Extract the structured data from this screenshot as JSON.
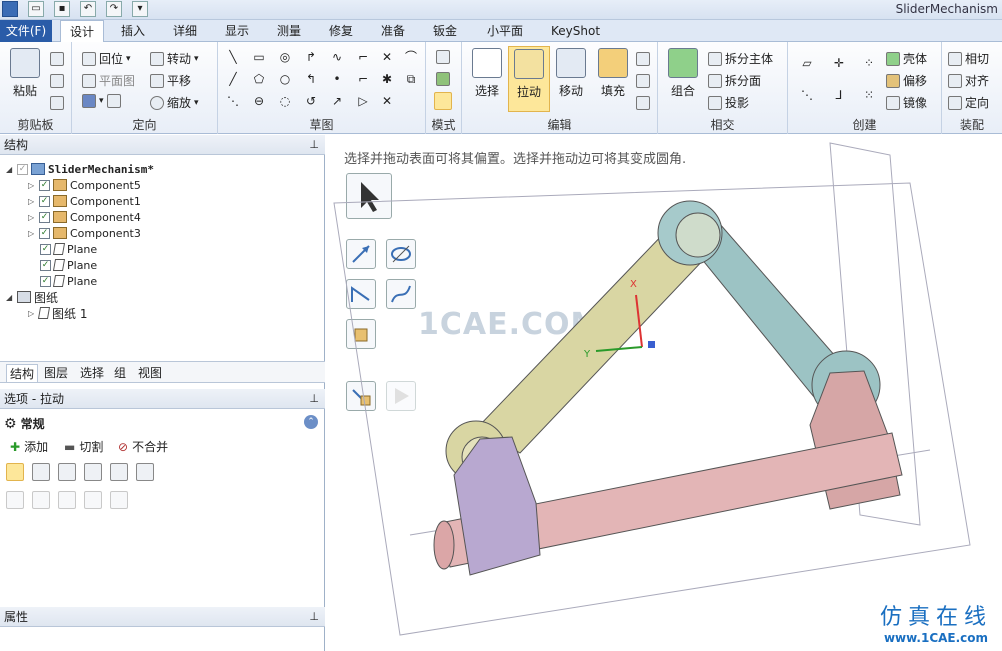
{
  "window": {
    "title": "SliderMechanism"
  },
  "tabs": [
    {
      "label": "文件(F)"
    },
    {
      "label": "设计"
    },
    {
      "label": "插入"
    },
    {
      "label": "详细"
    },
    {
      "label": "显示"
    },
    {
      "label": "测量"
    },
    {
      "label": "修复"
    },
    {
      "label": "准备"
    },
    {
      "label": "钣金"
    },
    {
      "label": "小平面"
    },
    {
      "label": "KeyShot"
    }
  ],
  "ribbon": {
    "clipboard": {
      "label": "剪贴板",
      "paste": "粘贴"
    },
    "orient": {
      "label": "定向",
      "home": "回位",
      "plan_view": "平面图",
      "spin": "转动",
      "pan": "平移",
      "zoom": "缩放"
    },
    "sketch": {
      "label": "草图"
    },
    "mode": {
      "label": "模式"
    },
    "edit": {
      "label": "编辑",
      "select": "选择",
      "pull": "拉动",
      "move": "移动",
      "fill": "填充"
    },
    "intersect": {
      "label": "相交",
      "combine": "组合",
      "split_body": "拆分主体",
      "split_face": "拆分面",
      "project": "投影"
    },
    "create": {
      "label": "创建",
      "shell": "壳体",
      "offset": "偏移",
      "mirror": "镜像"
    },
    "assembly": {
      "label": "装配",
      "tangent": "相切",
      "align": "对齐",
      "orient": "定向"
    }
  },
  "structure": {
    "title": "结构",
    "root": "SliderMechanism*",
    "components": [
      "Component5",
      "Component1",
      "Component4",
      "Component3"
    ],
    "planes": [
      "Plane",
      "Plane",
      "Plane"
    ],
    "drawings_label": "图纸",
    "drawing_sheet": "图纸 1"
  },
  "panel_tabs": [
    "结构",
    "图层",
    "选择",
    "组",
    "视图"
  ],
  "options": {
    "title": "选项 - 拉动",
    "section": "常规",
    "add": "添加",
    "cut": "切割",
    "no_merge": "不合并"
  },
  "properties": {
    "title": "属性"
  },
  "viewport": {
    "hint": "选择并拖动表面可将其偏置。选择并拖动边可将其变成圆角.",
    "watermark": "1CAE.COM",
    "axis_x": "X",
    "axis_y": "Y"
  },
  "brand": {
    "line1": "仿真在线",
    "line2": "www.1CAE.com"
  },
  "colors": {
    "accent_blue": "#2a5ca8",
    "selected": "#fde79a",
    "link_yellow": "#d9d6a3",
    "link_teal": "#9cc3c4",
    "slider_pink": "#e3b5b6",
    "block_purple": "#b8a8d0"
  }
}
